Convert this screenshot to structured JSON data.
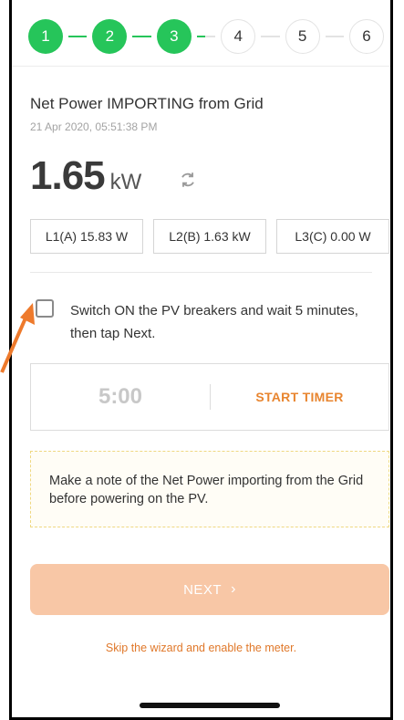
{
  "stepper": {
    "steps": [
      {
        "label": "1",
        "state": "done"
      },
      {
        "label": "2",
        "state": "done"
      },
      {
        "label": "3",
        "state": "done"
      },
      {
        "label": "4",
        "state": "todo"
      },
      {
        "label": "5",
        "state": "todo"
      },
      {
        "label": "6",
        "state": "todo"
      }
    ]
  },
  "header": {
    "title": "Net Power IMPORTING from Grid",
    "timestamp": "21 Apr 2020, 05:51:38 PM"
  },
  "power": {
    "value": "1.65",
    "unit": "kW",
    "refresh_icon": "refresh-icon"
  },
  "phases": [
    {
      "label": "L1(A) 15.83 W"
    },
    {
      "label": "L2(B) 1.63 kW"
    },
    {
      "label": "L3(C) 0.00 W"
    }
  ],
  "instruction": {
    "checked": false,
    "text": "Switch ON the PV breakers and wait 5 minutes, then tap Next."
  },
  "timer": {
    "value": "5:00",
    "button_label": "START TIMER"
  },
  "note": {
    "text": "Make a note of the Net Power importing from the Grid before powering on the PV."
  },
  "next_button": {
    "label": "NEXT",
    "chevron": "›"
  },
  "skip_link": "Skip the wizard and enable the meter.",
  "colors": {
    "step_done": "#26c55a",
    "accent": "#e8852f",
    "next_disabled": "#f8c7a6",
    "annotation_arrow": "#ee7a2c"
  }
}
